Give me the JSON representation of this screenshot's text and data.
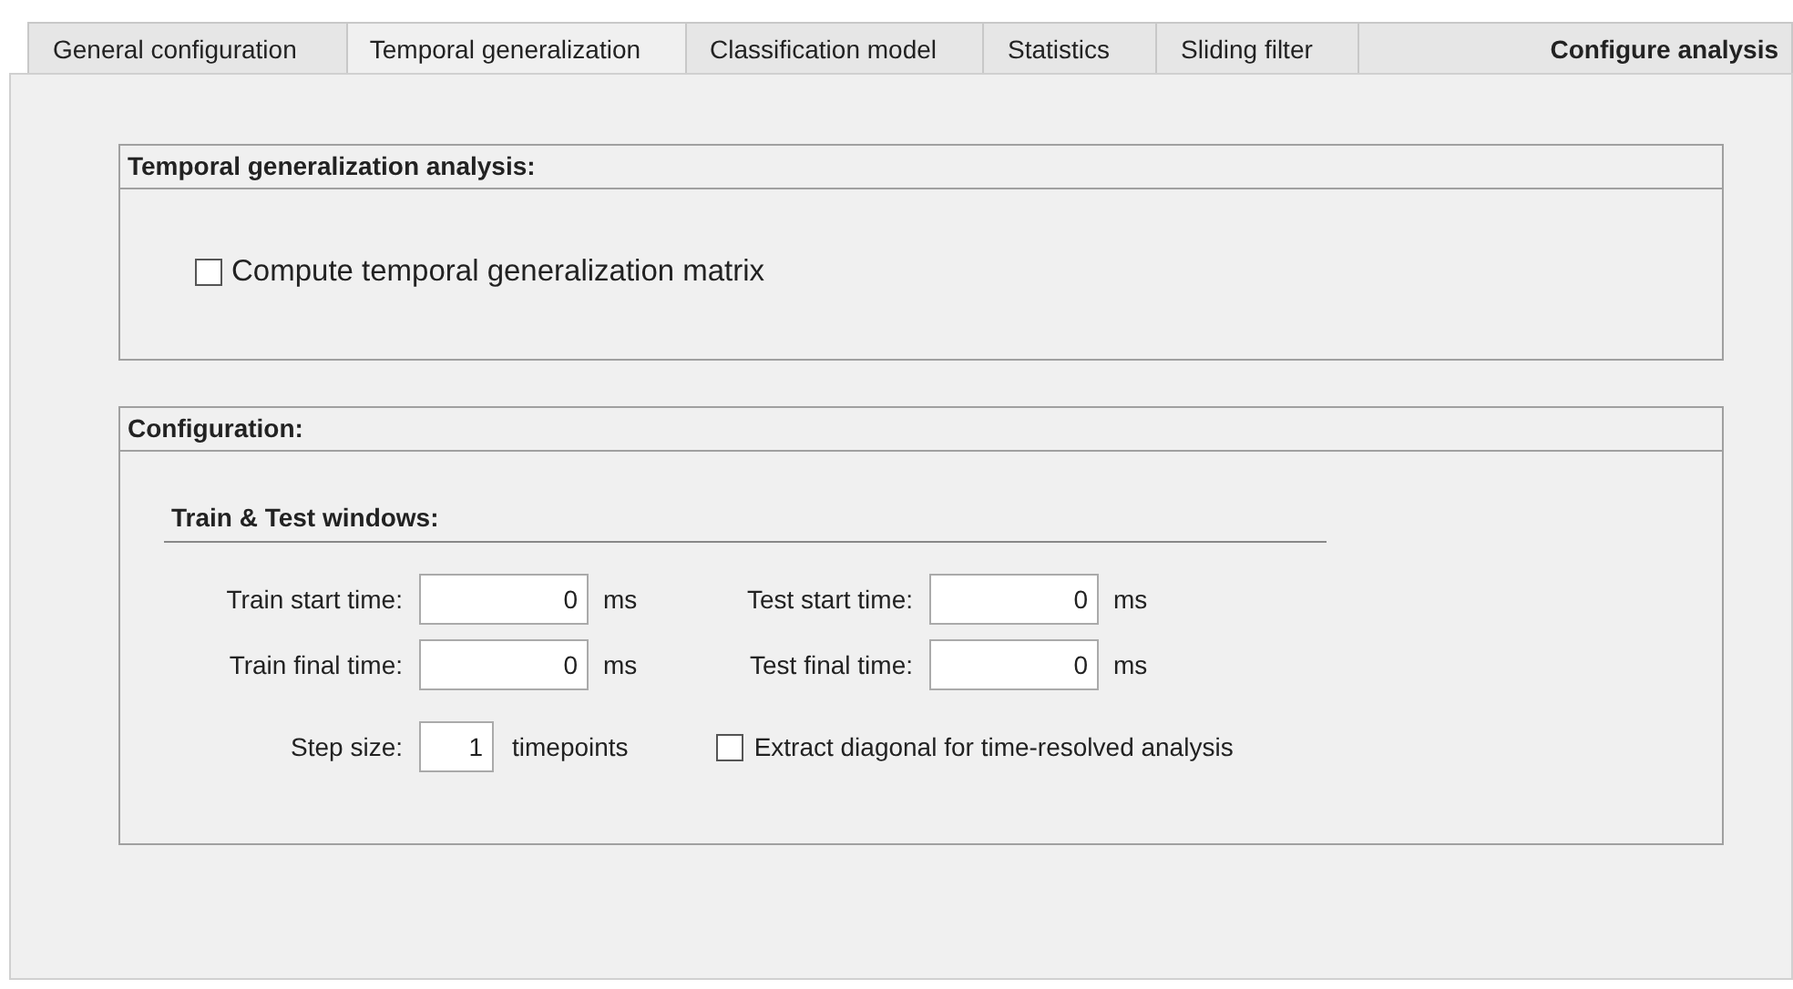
{
  "tabs": [
    {
      "label": "General configuration",
      "selected": false
    },
    {
      "label": "Temporal generalization",
      "selected": true
    },
    {
      "label": "Classification model",
      "selected": false
    },
    {
      "label": "Statistics",
      "selected": false
    },
    {
      "label": "Sliding filter",
      "selected": false
    }
  ],
  "action_button": {
    "label": "Configure analysis"
  },
  "analysis_panel": {
    "title": "Temporal generalization analysis:",
    "checkbox": {
      "label": "Compute temporal generalization matrix",
      "checked": false
    }
  },
  "configuration_panel": {
    "title": "Configuration:",
    "section": "Train & Test windows:",
    "fields": [
      {
        "label": "Train start time:",
        "value": "0",
        "unit": "ms"
      },
      {
        "label": "Test start time:",
        "value": "0",
        "unit": "ms"
      },
      {
        "label": "Train final time:",
        "value": "0",
        "unit": "ms"
      },
      {
        "label": "Test final time:",
        "value": "0",
        "unit": "ms"
      }
    ],
    "step": {
      "label": "Step size:",
      "value": "1",
      "unit": "timepoints"
    },
    "checkbox": {
      "label": "Extract diagonal for time-resolved analysis",
      "checked": false
    }
  }
}
